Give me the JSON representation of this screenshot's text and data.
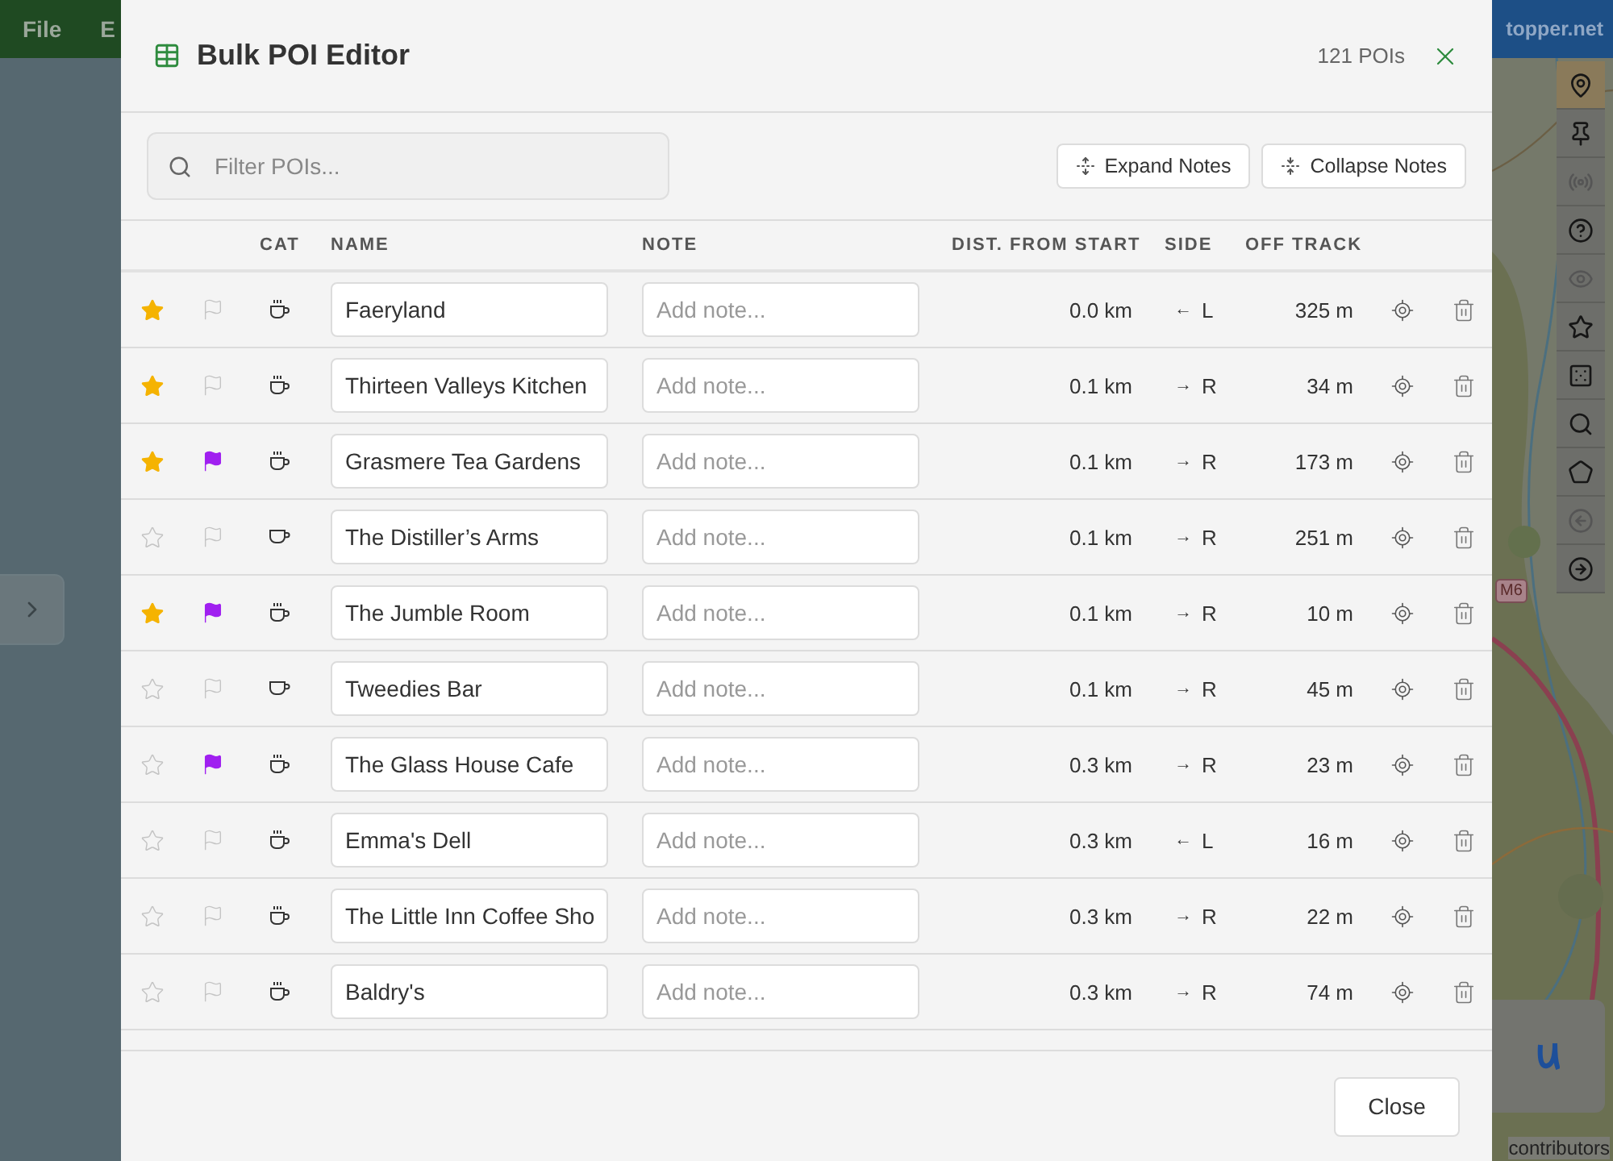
{
  "menu_bar": {
    "items": [
      "File",
      "E"
    ],
    "site": "topper.net"
  },
  "map": {
    "road_label": "M6",
    "attribution": "contributors",
    "tools": [
      {
        "kind": "pin",
        "selected": true,
        "disabled": false
      },
      {
        "kind": "pin-base",
        "selected": false,
        "disabled": false
      },
      {
        "kind": "broadcast",
        "selected": false,
        "disabled": true
      },
      {
        "kind": "help",
        "selected": false,
        "disabled": false
      },
      {
        "kind": "eye",
        "selected": false,
        "disabled": true
      },
      {
        "kind": "star",
        "selected": false,
        "disabled": false
      },
      {
        "kind": "dice",
        "selected": false,
        "disabled": false
      },
      {
        "kind": "search",
        "selected": false,
        "disabled": false
      },
      {
        "kind": "pentagon",
        "selected": false,
        "disabled": false
      },
      {
        "kind": "back",
        "selected": false,
        "disabled": true
      },
      {
        "kind": "forward",
        "selected": false,
        "disabled": false
      }
    ]
  },
  "dialog": {
    "title": "Bulk POI Editor",
    "count": "121 POIs",
    "search": {
      "placeholder": "Filter POIs..."
    },
    "buttons": [
      {
        "kind": "expand",
        "label": "Expand Notes"
      },
      {
        "kind": "collapse",
        "label": "Collapse Notes"
      }
    ],
    "columns": [
      "CAT",
      "NAME",
      "NOTE",
      "DIST. FROM START",
      "SIDE",
      "OFF TRACK"
    ],
    "rows": [
      {
        "starred": true,
        "flagged": false,
        "kind": "cafe",
        "name": "Faeryland",
        "note_placeholder": "Add note...",
        "distance": "0.0 km",
        "side_arrow": "←",
        "side": "L",
        "off_track": "325 m"
      },
      {
        "starred": true,
        "flagged": false,
        "kind": "cafe",
        "name": "Thirteen Valleys Kitchen",
        "note_placeholder": "Add note...",
        "distance": "0.1 km",
        "side_arrow": "→",
        "side": "R",
        "off_track": "34 m"
      },
      {
        "starred": true,
        "flagged": true,
        "kind": "cafe",
        "name": "Grasmere Tea Gardens",
        "note_placeholder": "Add note...",
        "distance": "0.1 km",
        "side_arrow": "→",
        "side": "R",
        "off_track": "173 m"
      },
      {
        "starred": false,
        "flagged": false,
        "kind": "pub",
        "name": "The Distiller’s Arms",
        "note_placeholder": "Add note...",
        "distance": "0.1 km",
        "side_arrow": "→",
        "side": "R",
        "off_track": "251 m"
      },
      {
        "starred": true,
        "flagged": true,
        "kind": "cafe",
        "name": "The Jumble Room",
        "note_placeholder": "Add note...",
        "distance": "0.1 km",
        "side_arrow": "→",
        "side": "R",
        "off_track": "10 m"
      },
      {
        "starred": false,
        "flagged": false,
        "kind": "pub",
        "name": "Tweedies Bar",
        "note_placeholder": "Add note...",
        "distance": "0.1 km",
        "side_arrow": "→",
        "side": "R",
        "off_track": "45 m"
      },
      {
        "starred": false,
        "flagged": true,
        "kind": "cafe",
        "name": "The Glass House Cafe",
        "note_placeholder": "Add note...",
        "distance": "0.3 km",
        "side_arrow": "→",
        "side": "R",
        "off_track": "23 m"
      },
      {
        "starred": false,
        "flagged": false,
        "kind": "cafe",
        "name": "Emma's Dell",
        "note_placeholder": "Add note...",
        "distance": "0.3 km",
        "side_arrow": "←",
        "side": "L",
        "off_track": "16 m"
      },
      {
        "starred": false,
        "flagged": false,
        "kind": "cafe",
        "name": "The Little Inn Coffee Sho",
        "note_placeholder": "Add note...",
        "distance": "0.3 km",
        "side_arrow": "→",
        "side": "R",
        "off_track": "22 m"
      },
      {
        "starred": false,
        "flagged": false,
        "kind": "cafe",
        "name": "Baldry's",
        "note_placeholder": "Add note...",
        "distance": "0.3 km",
        "side_arrow": "→",
        "side": "R",
        "off_track": "74 m"
      }
    ],
    "close_label": "Close"
  }
}
